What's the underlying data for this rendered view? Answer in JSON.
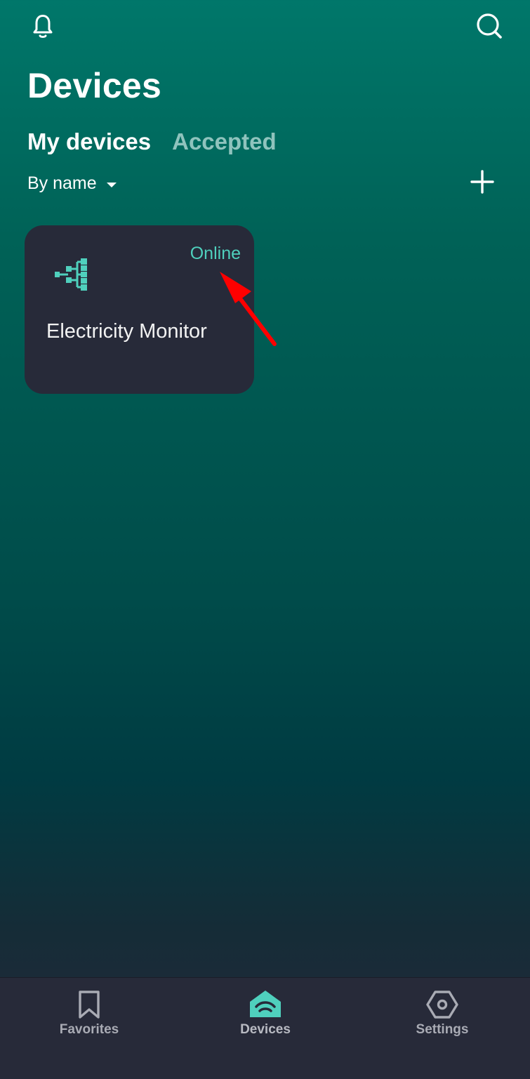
{
  "header": {
    "bell_icon": "bell-icon",
    "search_icon": "search-icon"
  },
  "page": {
    "title": "Devices"
  },
  "tabs": [
    {
      "label": "My devices",
      "active": true
    },
    {
      "label": "Accepted",
      "active": false
    }
  ],
  "sort": {
    "label": "By name",
    "icon": "caret-down-icon"
  },
  "toolbar": {
    "add_icon": "plus-icon"
  },
  "devices": [
    {
      "name": "Electricity Monitor",
      "status": "Online",
      "icon": "hierarchy-diagram-icon"
    }
  ],
  "annotation": {
    "type": "red-arrow",
    "points_to": "device-status"
  },
  "bottom_nav": [
    {
      "label": "Favorites",
      "icon": "bookmark-icon",
      "active": false
    },
    {
      "label": "Devices",
      "icon": "devices-home-icon",
      "active": true
    },
    {
      "label": "Settings",
      "icon": "settings-hexagon-icon",
      "active": false
    }
  ],
  "colors": {
    "background_top": "#00776a",
    "background_bottom": "#25293a",
    "card": "#272a39",
    "accent": "#4fd0bd",
    "inactive_tab": "#8fc3bd",
    "nav_bar": "#272a39",
    "arrow": "#ff0000"
  }
}
